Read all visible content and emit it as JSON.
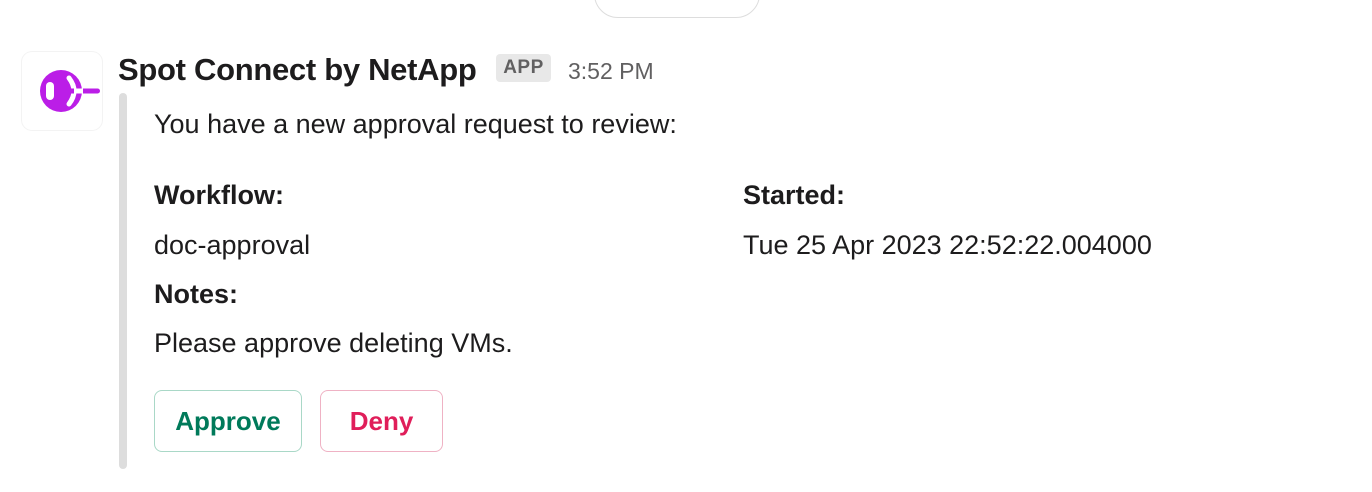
{
  "message": {
    "sender_name": "Spot Connect by NetApp",
    "badge": "APP",
    "timestamp": "3:52 PM",
    "avatar_icon": "netapp-spot-logo-icon",
    "brand_color": "#bb1ee7"
  },
  "attachment": {
    "intro": "You have a new approval request to review:",
    "fields": {
      "workflow_label": "Workflow:",
      "workflow_value": "doc-approval",
      "started_label": "Started:",
      "started_value": "Tue 25 Apr 2023 22:52:22.004000",
      "notes_label": "Notes:",
      "notes_value": "Please approve deleting VMs."
    },
    "actions": {
      "approve_label": "Approve",
      "approve_color": "#007a5a",
      "deny_label": "Deny",
      "deny_color": "#e01e5a"
    }
  }
}
